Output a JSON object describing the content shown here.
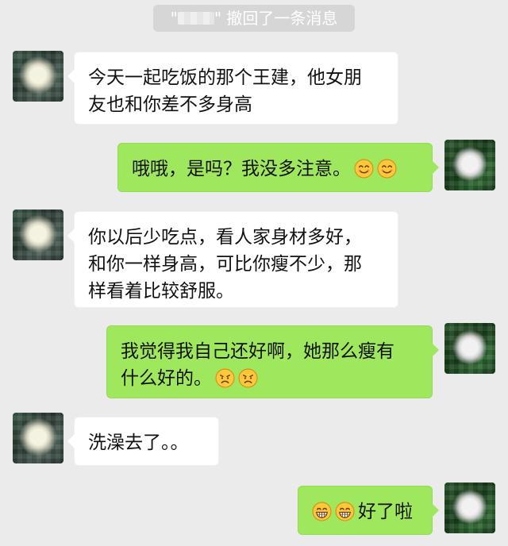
{
  "system_message": {
    "quote_open": "\"",
    "quote_close": "\"",
    "text": "撤回了一条消息"
  },
  "messages": [
    {
      "direction": "incoming",
      "lines": [
        "今天一起吃饭的那个王建，他女朋",
        "友也和你差不多身高"
      ]
    },
    {
      "direction": "outgoing",
      "text": "哦哦，是吗？我没多注意。",
      "emoji": [
        "smile-icon",
        "smile-icon"
      ]
    },
    {
      "direction": "incoming",
      "lines": [
        "你以后少吃点，看人家身材多好，",
        "和你一样身高，可比你瘦不少，那",
        "样看着比较舒服。"
      ]
    },
    {
      "direction": "outgoing",
      "lines": [
        "我觉得我自己还好啊，她那么瘦有",
        "什么好的。"
      ],
      "emoji": [
        "frown-icon",
        "frown-icon"
      ]
    },
    {
      "direction": "incoming",
      "text": "洗澡去了。。"
    },
    {
      "direction": "outgoing",
      "text": "好了啦",
      "emoji": [
        "grin-icon",
        "grin-icon"
      ]
    }
  ],
  "colors": {
    "background": "#ebebeb",
    "incoming_bubble": "#ffffff",
    "outgoing_bubble": "#9fe75d",
    "system_message": "#d6d6d6"
  }
}
